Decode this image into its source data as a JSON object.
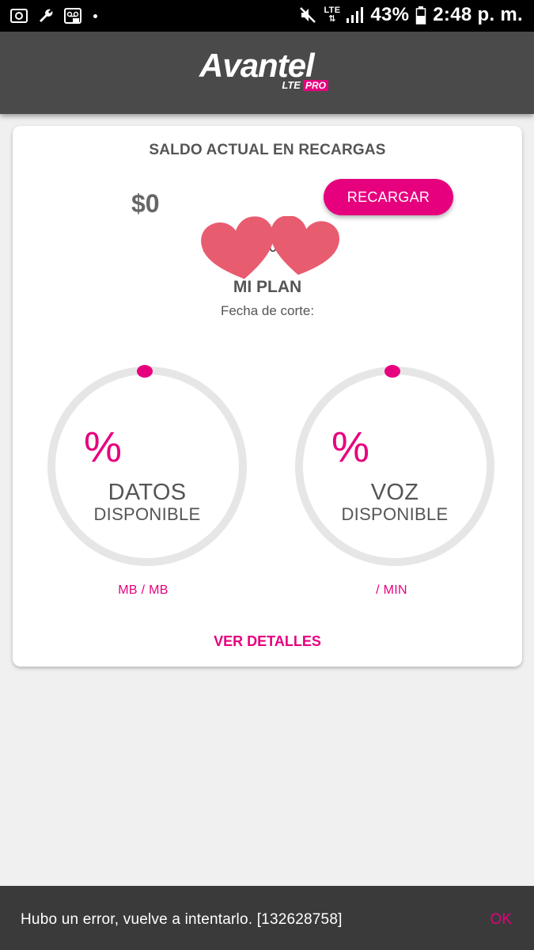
{
  "status_bar": {
    "network": "LTE",
    "battery": "43%",
    "time": "2:48 p. m.",
    "icons": [
      "screenshot-icon",
      "wrench-icon",
      "voicemail-icon",
      "mute-icon",
      "signal-icon",
      "battery-icon"
    ]
  },
  "header": {
    "logo_word": "Avantel",
    "logo_lte": "LTE",
    "logo_pro": "PRO"
  },
  "card": {
    "saldo_title": "SALDO ACTUAL EN RECARGAS",
    "saldo_amount": "$0",
    "recargar_label": "RECARGAR",
    "phone_visible_left": "l",
    "phone_visible_right": "04",
    "plan_title": "MI PLAN",
    "fecha_label": "Fecha de corte:",
    "gauges": [
      {
        "percent_symbol": "%",
        "label": "DATOS",
        "sublabel": "DISPONIBLE",
        "unit": "MB / MB"
      },
      {
        "percent_symbol": "%",
        "label": "VOZ",
        "sublabel": "DISPONIBLE",
        "unit": "/ MIN"
      }
    ],
    "ver_detalles": "VER DETALLES"
  },
  "snackbar": {
    "message": "Hubo un error, vuelve a intentarlo. [132628758]",
    "action": "OK"
  },
  "colors": {
    "accent": "#e6007e",
    "header_bg": "#4a4a4a",
    "page_bg": "#f0f0f0",
    "ring": "#e6e6e6"
  }
}
